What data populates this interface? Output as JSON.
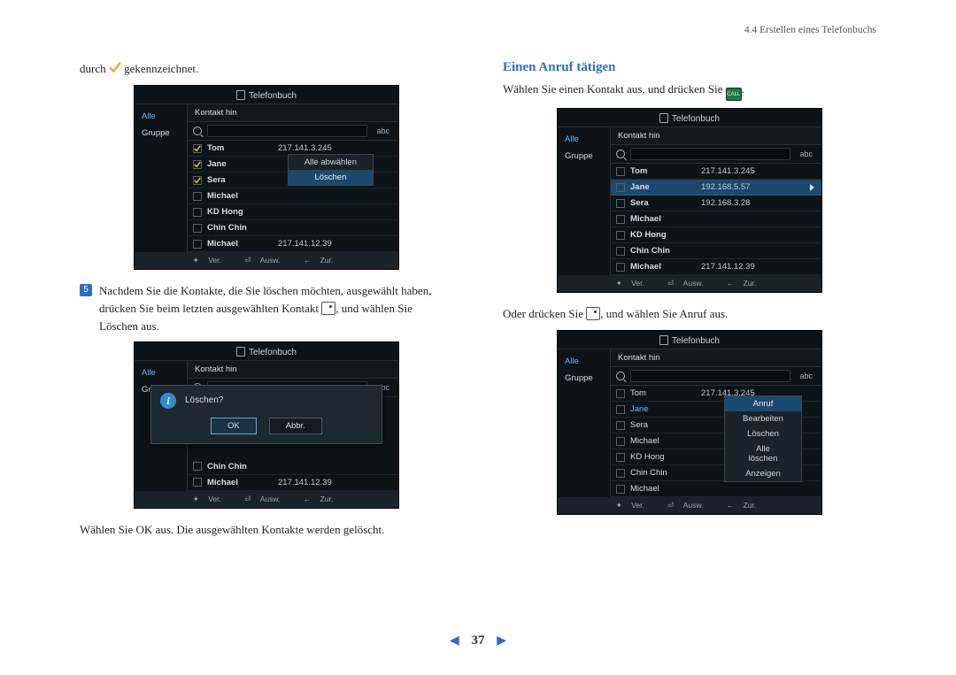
{
  "header": {
    "section": "4.4 Erstellen eines Telefonbuchs"
  },
  "left": {
    "intro_prefix": "durch",
    "intro_suffix": "gekennzeichnet.",
    "step_num": "5",
    "step_a": "Nachdem Sie die Kontakte, die Sie löschen möchten, ausgewählt haben,",
    "step_b_pre": "drücken Sie beim letzten ausgewählten Kontakt",
    "step_b_post": ", und wählen Sie",
    "step_c": "Löschen aus.",
    "closing": "Wählen Sie OK aus. Die ausgewählten Kontakte werden gelöscht."
  },
  "right": {
    "heading": "Einen Anruf tätigen",
    "p1_pre": "Wählen Sie einen Kontakt aus, und drücken Sie",
    "p1_post": ".",
    "p2_pre": "Oder drücken Sie",
    "p2_mid": ", und wählen Sie ",
    "p2_term": "Anruf",
    "p2_post": " aus."
  },
  "ui": {
    "title": "Telefonbuch",
    "tab_all": "Alle",
    "tab_group": "Gruppe",
    "header_contact": "Kontakt hin",
    "abc": "abc",
    "foot_ver": "Ver.",
    "foot_ausw": "Ausw.",
    "foot_zur": "Zur.",
    "popup_deselect": "Alle abwählen",
    "popup_delete": "Löschen",
    "dialog_q": "Löschen?",
    "btn_ok": "OK",
    "btn_cancel": "Abbr.",
    "menu_call": "Anruf",
    "menu_edit": "Bearbeiten",
    "menu_delete": "Löschen",
    "menu_delete_all": "Alle löschen",
    "menu_view": "Anzeigen",
    "call_label": "CALL"
  },
  "contacts1": [
    {
      "name": "Tom",
      "ip": "217.141.3.245",
      "checked": true
    },
    {
      "name": "Jane",
      "ip": "",
      "checked": true
    },
    {
      "name": "Sera",
      "ip": "",
      "checked": true
    },
    {
      "name": "Michael",
      "ip": "",
      "checked": false
    },
    {
      "name": "KD Hong",
      "ip": "",
      "checked": false
    },
    {
      "name": "Chin Chin",
      "ip": "",
      "checked": false
    },
    {
      "name": "Michael",
      "ip": "217.141.12.39",
      "checked": false
    }
  ],
  "contacts2_tail": [
    {
      "name": "Chin Chin",
      "ip": ""
    },
    {
      "name": "Michael",
      "ip": "217.141.12.39"
    }
  ],
  "contacts3": [
    {
      "name": "Tom",
      "ip": "217.141.3.245",
      "hl": false
    },
    {
      "name": "Jane",
      "ip": "192.168.5.57",
      "hl": true
    },
    {
      "name": "Sera",
      "ip": "192.168.3.28",
      "hl": false
    },
    {
      "name": "Michael",
      "ip": "",
      "hl": false
    },
    {
      "name": "KD Hong",
      "ip": "",
      "hl": false
    },
    {
      "name": "Chin Chin",
      "ip": "",
      "hl": false
    },
    {
      "name": "Michael",
      "ip": "217.141.12.39",
      "hl": false
    }
  ],
  "contacts4": [
    {
      "name": "Tom",
      "ip": "217.141.3.245",
      "sel": false
    },
    {
      "name": "Jane",
      "ip": "",
      "sel": true
    },
    {
      "name": "Sera",
      "ip": "",
      "sel": false
    },
    {
      "name": "Michael",
      "ip": "",
      "sel": false
    },
    {
      "name": "KD Hong",
      "ip": "",
      "sel": false
    },
    {
      "name": "Chin Chin",
      "ip": "",
      "sel": false
    },
    {
      "name": "Michael",
      "ip": "",
      "sel": false
    }
  ],
  "pager": {
    "num": "37"
  }
}
